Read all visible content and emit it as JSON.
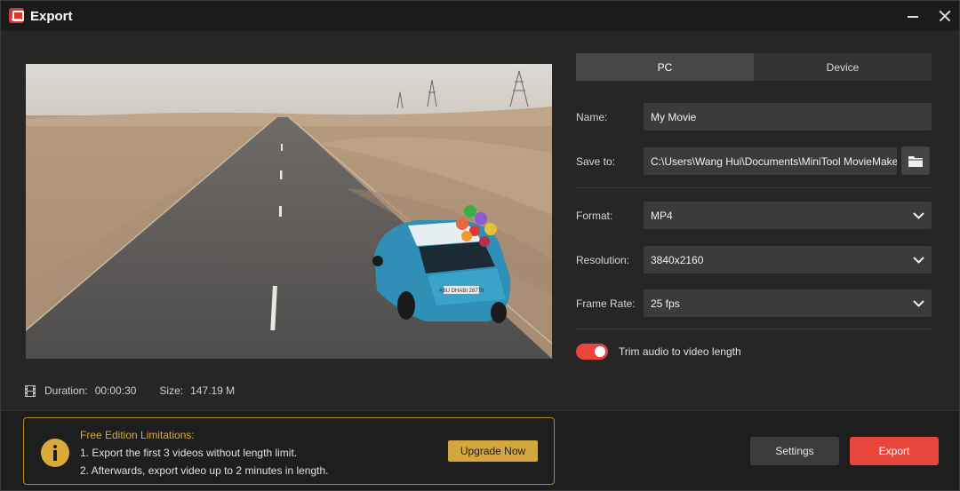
{
  "window": {
    "title": "Export"
  },
  "preview": {
    "duration_label": "Duration:",
    "duration_value": "00:00:30",
    "size_label": "Size:",
    "size_value": "147.19 M",
    "plate_text": "ABU DHABI 28778"
  },
  "tabs": [
    {
      "label": "PC",
      "active": true
    },
    {
      "label": "Device",
      "active": false
    }
  ],
  "form": {
    "name_label": "Name:",
    "name_value": "My Movie",
    "save_label": "Save to:",
    "save_value": "C:\\Users\\Wang Hui\\Documents\\MiniTool MovieMaker\\",
    "format_label": "Format:",
    "format_value": "MP4",
    "resolution_label": "Resolution:",
    "resolution_value": "3840x2160",
    "framerate_label": "Frame Rate:",
    "framerate_value": "25 fps",
    "trim_label": "Trim audio to video length",
    "trim_on": true
  },
  "limits": {
    "title": "Free Edition Limitations:",
    "line1": "1. Export the first 3 videos without length limit.",
    "line2": "2. Afterwards, export video up to 2 minutes in length.",
    "upgrade_label": "Upgrade Now"
  },
  "actions": {
    "settings_label": "Settings",
    "export_label": "Export"
  },
  "colors": {
    "accent": "#e8453c",
    "warning": "#d4a73e",
    "background": "#262626"
  }
}
